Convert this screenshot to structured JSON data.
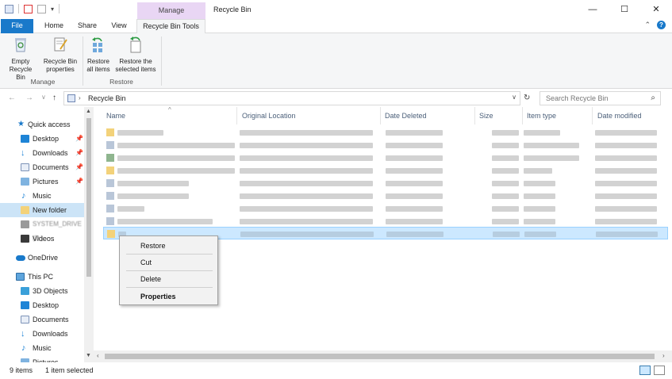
{
  "window": {
    "title": "Recycle Bin",
    "context_tab": "Manage",
    "min": "—",
    "max": "☐",
    "close": "✕"
  },
  "tabs": {
    "file": "File",
    "home": "Home",
    "share": "Share",
    "view": "View",
    "tools": "Recycle Bin Tools"
  },
  "ribbon": {
    "empty_l1": "Empty",
    "empty_l2": "Recycle Bin",
    "props_l1": "Recycle Bin",
    "props_l2": "properties",
    "manage_group": "Manage",
    "restore_all_l1": "Restore",
    "restore_all_l2": "all items",
    "restore_sel_l1": "Restore the",
    "restore_sel_l2": "selected items",
    "restore_group": "Restore"
  },
  "address": {
    "path": "Recycle Bin",
    "search_placeholder": "Search Recycle Bin"
  },
  "nav": {
    "quick_access": "Quick access",
    "desktop": "Desktop",
    "downloads": "Downloads",
    "documents": "Documents",
    "pictures": "Pictures",
    "music": "Music",
    "new_folder": "New folder",
    "obscured_item": "SYSTEM_DRIVE (D:)",
    "videos": "Videos",
    "onedrive": "OneDrive",
    "this_pc": "This PC",
    "objects3d": "3D Objects",
    "desktop2": "Desktop",
    "documents2": "Documents",
    "downloads2": "Downloads",
    "music2": "Music",
    "pictures2": "Pictures"
  },
  "columns": {
    "name": "Name",
    "original_location": "Original Location",
    "date_deleted": "Date Deleted",
    "size": "Size",
    "item_type": "Item type",
    "date_modified": "Date modified"
  },
  "context_menu": {
    "restore": "Restore",
    "cut": "Cut",
    "delete": "Delete",
    "properties": "Properties"
  },
  "status": {
    "count": "9 items",
    "selected": "1 item selected"
  },
  "colors": {
    "accent": "#1979ca",
    "manage_tab": "#e9d6f4",
    "selection": "#cce8ff"
  }
}
